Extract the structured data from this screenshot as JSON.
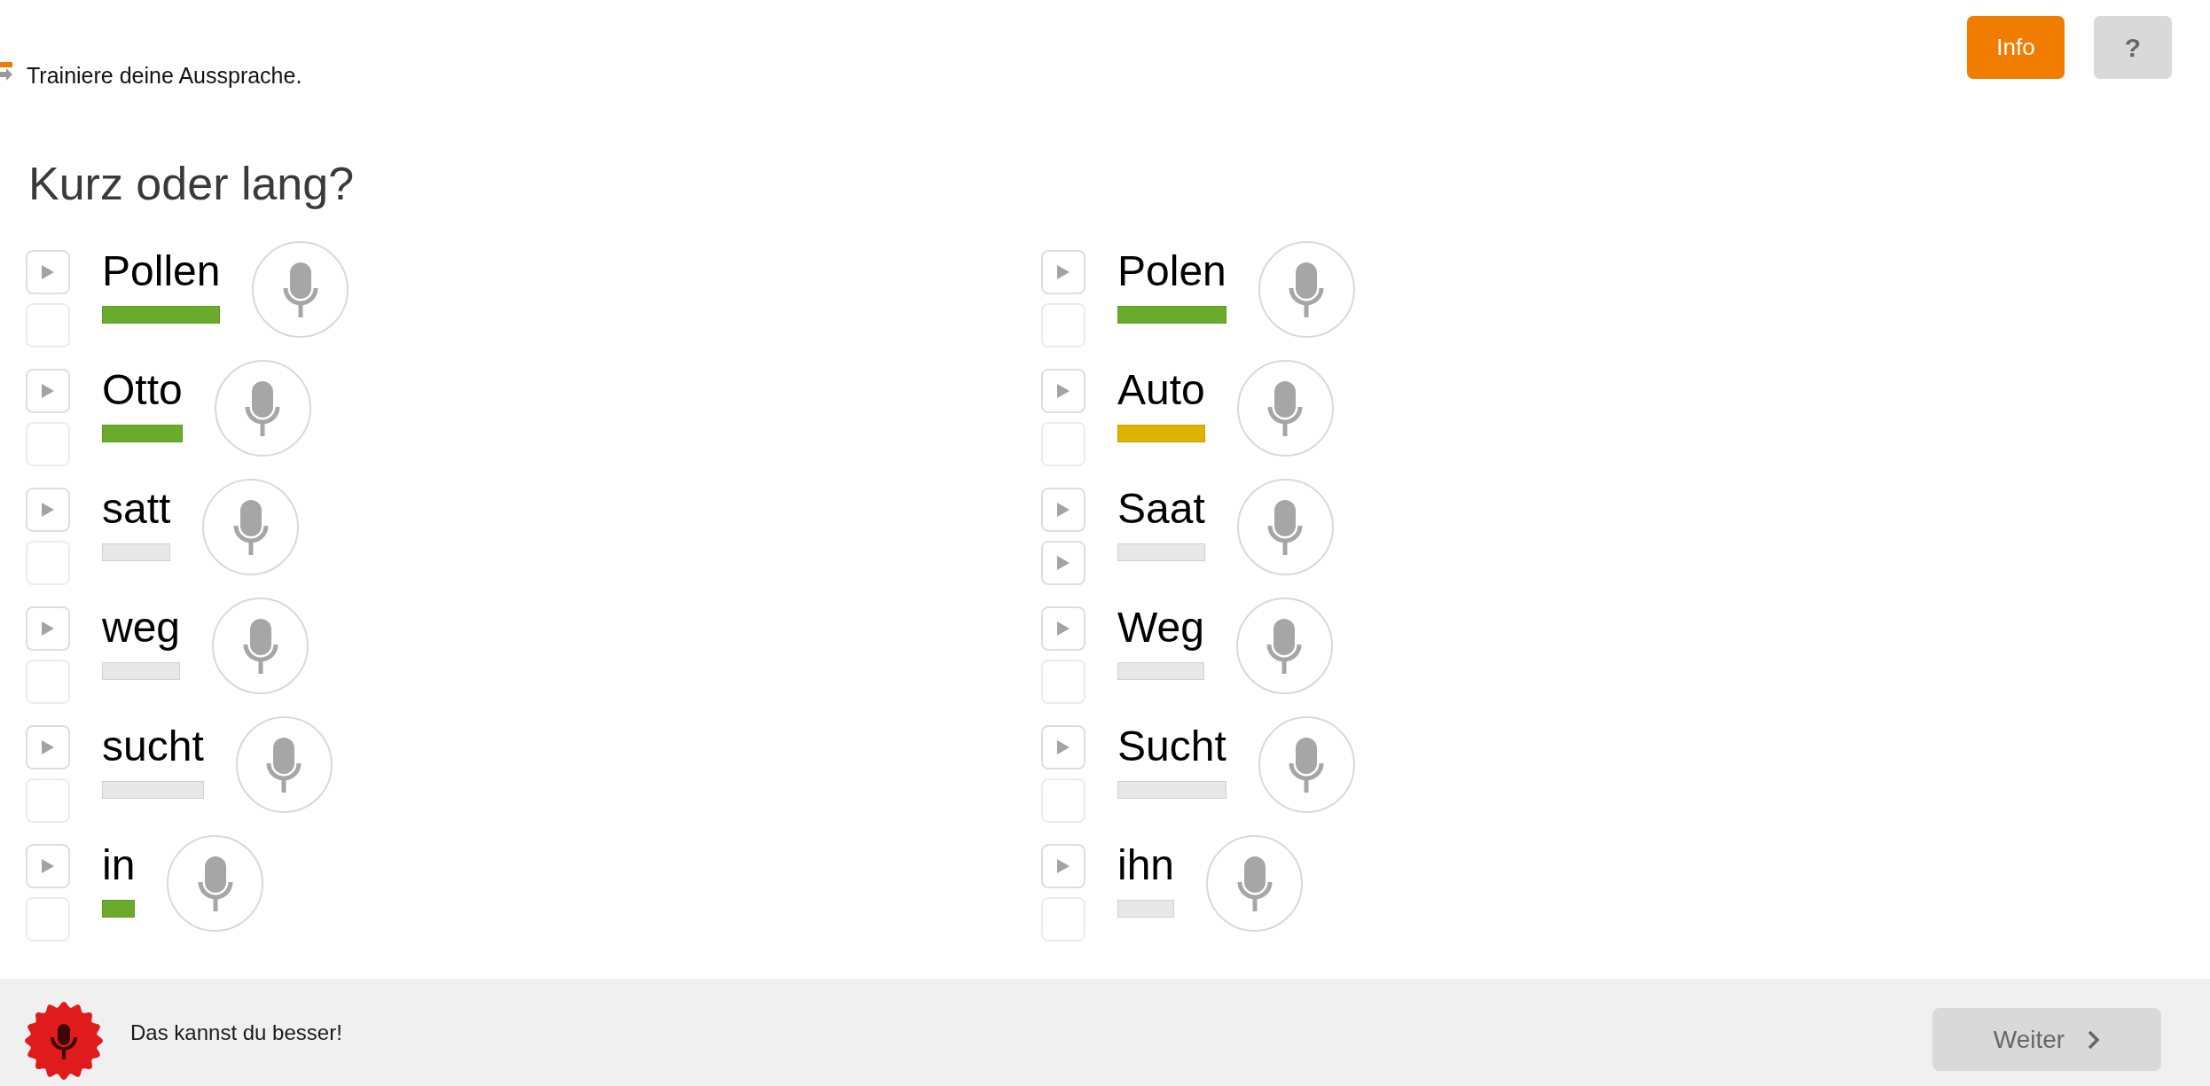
{
  "header": {
    "instruction": "Trainiere deine Aussprache.",
    "info_button": "Info",
    "help_button": "?"
  },
  "title": "Kurz oder lang?",
  "columns": [
    {
      "items": [
        {
          "word": "Pollen",
          "color": "#6aab2b",
          "own_recording": false
        },
        {
          "word": "Otto",
          "color": "#6aab2b",
          "own_recording": false
        },
        {
          "word": "satt",
          "color": "#e8e8e8",
          "own_recording": false
        },
        {
          "word": "weg",
          "color": "#e8e8e8",
          "own_recording": false
        },
        {
          "word": "sucht",
          "color": "#e8e8e8",
          "own_recording": false
        },
        {
          "word": "in",
          "color": "#6aab2b",
          "own_recording": false
        }
      ]
    },
    {
      "items": [
        {
          "word": "Polen",
          "color": "#6aab2b",
          "own_recording": false
        },
        {
          "word": "Auto",
          "color": "#ddb300",
          "own_recording": false
        },
        {
          "word": "Saat",
          "color": "#e8e8e8",
          "own_recording": true
        },
        {
          "word": "Weg",
          "color": "#e8e8e8",
          "own_recording": false
        },
        {
          "word": "Sucht",
          "color": "#e8e8e8",
          "own_recording": false
        },
        {
          "word": "ihn",
          "color": "#e8e8e8",
          "own_recording": false
        }
      ]
    }
  ],
  "footer": {
    "message": "Das kannst du besser!",
    "next_button": {
      "label": "Weiter",
      "disabled": true
    }
  }
}
